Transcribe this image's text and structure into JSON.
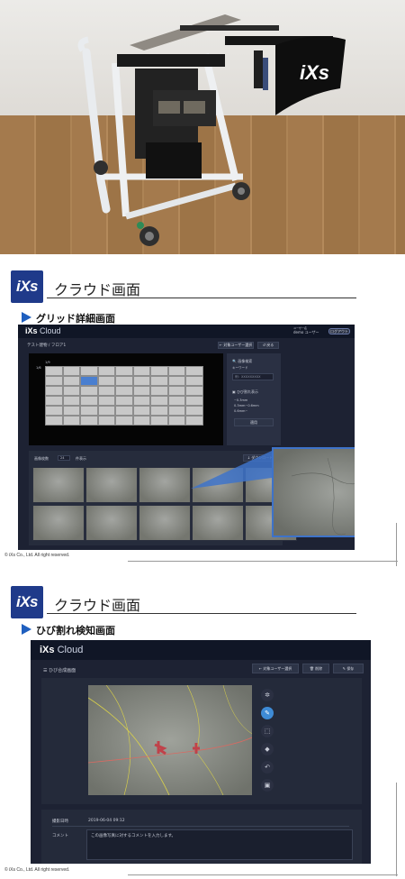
{
  "sections": [
    {
      "title": "クラウド画面",
      "subtitle": "グリッド詳細画面",
      "app": {
        "brand": "iXs",
        "brand_suffix": "Cloud",
        "user_hint": "ユーザー名",
        "user_name": "demo ユーザー",
        "logout": "ログアウト",
        "page_title": "テスト建物 / フロア1",
        "btn_user_select": "← 対象ユーザー選択",
        "btn_back": "↺ 戻る",
        "side_search_title": "画像検索",
        "side_keyword_label": "キーワード",
        "side_keyword_placeholder": "例：XXXXXXXXX",
        "side_crack_title": "ひび割れ表示",
        "crack_options": [
          "~0.3mm",
          "0.3mm~0.6mm",
          "0.6mm~"
        ],
        "side_apply": "適用",
        "images_label": "画像枚数",
        "images_count": "24",
        "images_unit": "件表示",
        "btn_download": "↓ ダウンロード",
        "grid_row_label": "1/6",
        "grid_col_label": "1/9"
      },
      "copyright": "© iXs Co., Ltd. All right reserved."
    },
    {
      "title": "クラウド画面",
      "subtitle": "ひび割れ検知画面",
      "app": {
        "brand": "iXs",
        "brand_suffix": "Cloud",
        "page_title": "ひび合成画面",
        "btn_user_select": "← 対象ユーザー選択",
        "btn_delete": "削除",
        "btn_save": "保存",
        "date_label": "撮影日時",
        "date_value": "2019-06-04 09:12",
        "comment_label": "コメント",
        "comment_value": "この画像写真に対するコメントを入力します。"
      },
      "copyright": "© iXs Co., Ltd. All right reserved."
    }
  ],
  "photo": {
    "robot_brand": "iXs"
  },
  "colors": {
    "logo_blue": "#1f3a8a",
    "accent_blue": "#1f5fbf",
    "app_bg": "#1d2233",
    "app_bar": "#101626",
    "grid_highlight": "#4a7fd0"
  }
}
